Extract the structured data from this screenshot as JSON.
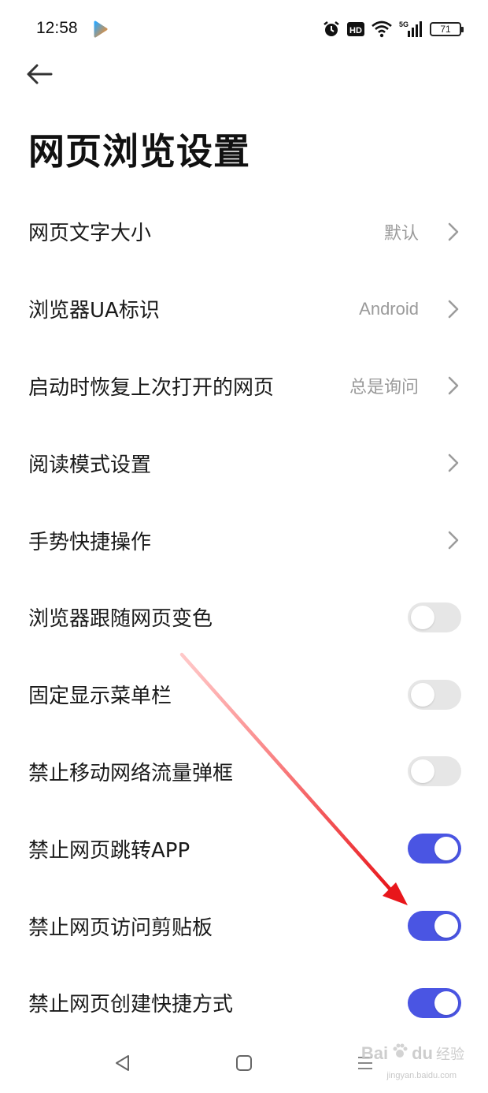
{
  "status_bar": {
    "time": "12:58",
    "app_icon": "play-arrow-icon",
    "icons": [
      "alarm-clock-icon",
      "hd-icon",
      "wifi-icon",
      "signal-5g-icon"
    ],
    "hd_label": "HD",
    "signal_label": "5G",
    "battery_level": "71"
  },
  "header": {
    "back_icon": "arrow-left-icon",
    "title": "网页浏览设置"
  },
  "settings": [
    {
      "label": "网页文字大小",
      "value": "默认",
      "type": "link"
    },
    {
      "label": "浏览器UA标识",
      "value": "Android",
      "type": "link"
    },
    {
      "label": "启动时恢复上次打开的网页",
      "value": "总是询问",
      "type": "link"
    },
    {
      "label": "阅读模式设置",
      "value": "",
      "type": "link"
    },
    {
      "label": "手势快捷操作",
      "value": "",
      "type": "link"
    },
    {
      "label": "浏览器跟随网页变色",
      "enabled": false,
      "type": "toggle"
    },
    {
      "label": "固定显示菜单栏",
      "enabled": false,
      "type": "toggle"
    },
    {
      "label": "禁止移动网络流量弹框",
      "enabled": false,
      "type": "toggle"
    },
    {
      "label": "禁止网页跳转APP",
      "enabled": true,
      "type": "toggle"
    },
    {
      "label": "禁止网页访问剪贴板",
      "enabled": true,
      "type": "toggle"
    },
    {
      "label": "禁止网页创建快捷方式",
      "enabled": true,
      "type": "toggle"
    }
  ],
  "colors": {
    "toggle_on": "#4a55e3",
    "toggle_off": "#e6e6e6",
    "annotation_arrow": "#e8161b"
  },
  "nav_bar": {
    "buttons": [
      "back-triangle-icon",
      "home-square-icon",
      "menu-lines-icon"
    ]
  },
  "watermark": {
    "brand": "Bai",
    "brand_suffix": "du",
    "cn": "经验",
    "url": "jingyan.baidu.com"
  }
}
